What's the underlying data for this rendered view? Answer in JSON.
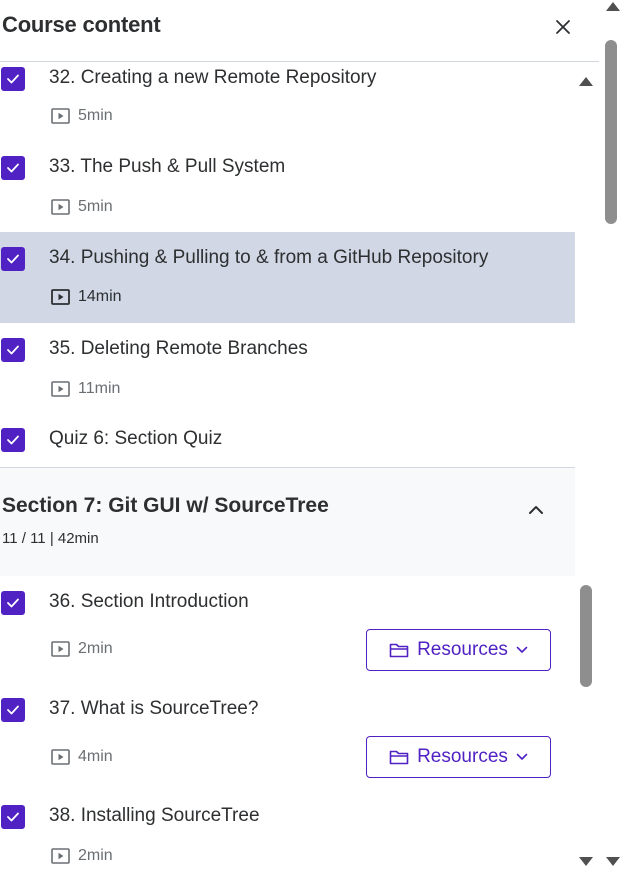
{
  "header": {
    "title": "Course content"
  },
  "items_top": [
    {
      "title": "32. Creating a new Remote Repository",
      "duration": "5min"
    },
    {
      "title": "33. The Push & Pull System",
      "duration": "5min"
    },
    {
      "title": "34. Pushing & Pulling to & from a GitHub Repository",
      "duration": "14min"
    },
    {
      "title": "35. Deleting Remote Branches",
      "duration": "11min"
    },
    {
      "title": "Quiz 6: Section Quiz"
    }
  ],
  "section": {
    "title": "Section 7: Git GUI w/ SourceTree",
    "progress": "11 / 11 | 42min"
  },
  "items_bottom": [
    {
      "title": "36. Section Introduction",
      "duration": "2min",
      "resources_label": "Resources"
    },
    {
      "title": "37. What is SourceTree?",
      "duration": "4min",
      "resources_label": "Resources"
    },
    {
      "title": "38. Installing SourceTree",
      "duration": "2min"
    }
  ],
  "colors": {
    "accent": "#5022c3",
    "active_row": "#d1d7e4",
    "section_bg": "#f7f9fa"
  },
  "icons": {
    "checkbox": "check-icon",
    "video": "video-icon",
    "folder": "folder-icon",
    "chevron": "chevron-down-icon",
    "close": "close-icon"
  }
}
